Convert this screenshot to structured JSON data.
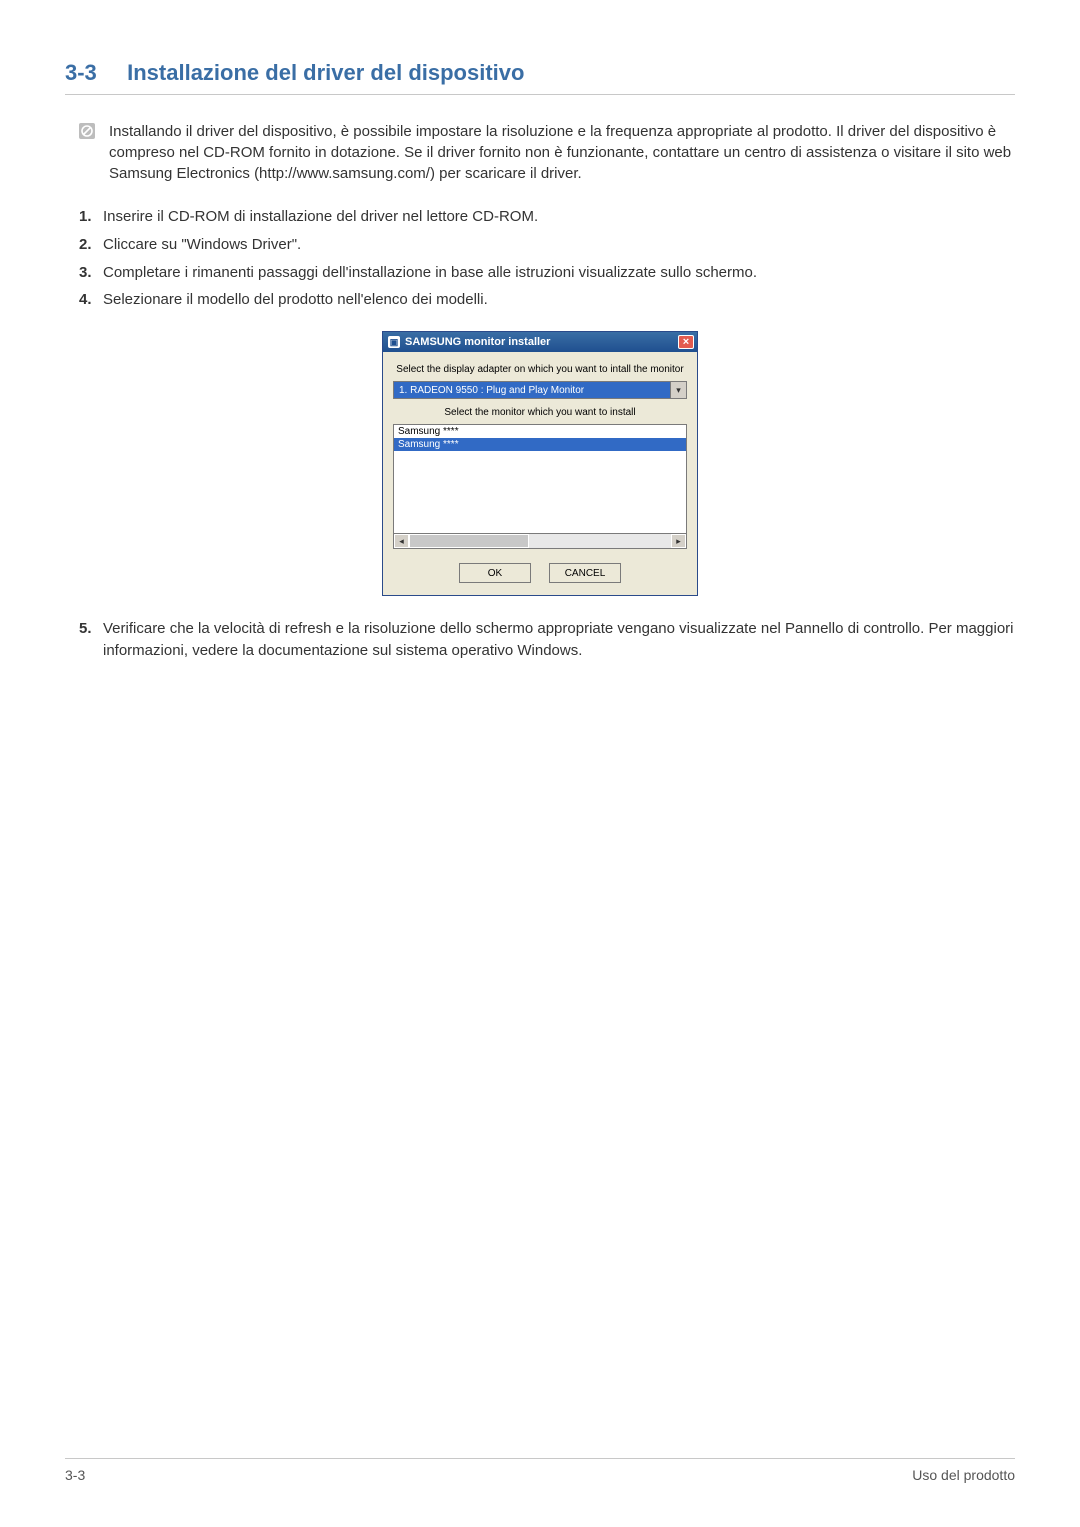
{
  "heading": {
    "number": "3-3",
    "title": "Installazione del driver del dispositivo"
  },
  "info_text": "Installando il driver del dispositivo, è possibile impostare la risoluzione e la frequenza appropriate al prodotto. Il driver del dispositivo è compreso nel CD-ROM fornito in dotazione. Se il driver fornito non è funzionante, contattare un centro di assistenza o visitare il sito web Samsung Electronics (http://www.samsung.com/) per scaricare il driver.",
  "steps": [
    "Inserire il CD-ROM di installazione del driver nel lettore CD-ROM.",
    "Cliccare su \"Windows Driver\".",
    "Completare i rimanenti passaggi dell'installazione in base alle istruzioni visualizzate sullo schermo.",
    "Selezionare il modello del prodotto nell'elenco dei modelli."
  ],
  "dialog": {
    "title": "SAMSUNG monitor installer",
    "label_adapter": "Select the display adapter on which you want to intall the monitor",
    "combo_value": "1. RADEON 9550 : Plug and Play Monitor",
    "label_monitor": "Select the monitor which you want to install",
    "list_items": [
      "Samsung ****",
      "Samsung ****"
    ],
    "ok": "OK",
    "cancel": "CANCEL"
  },
  "step5": "Verificare che la velocità di refresh e la risoluzione dello schermo appropriate vengano visualizzate nel Pannello di controllo. Per maggiori informazioni, vedere la documentazione sul sistema operativo Windows.",
  "footer": {
    "left": "3-3",
    "right": "Uso del prodotto"
  }
}
